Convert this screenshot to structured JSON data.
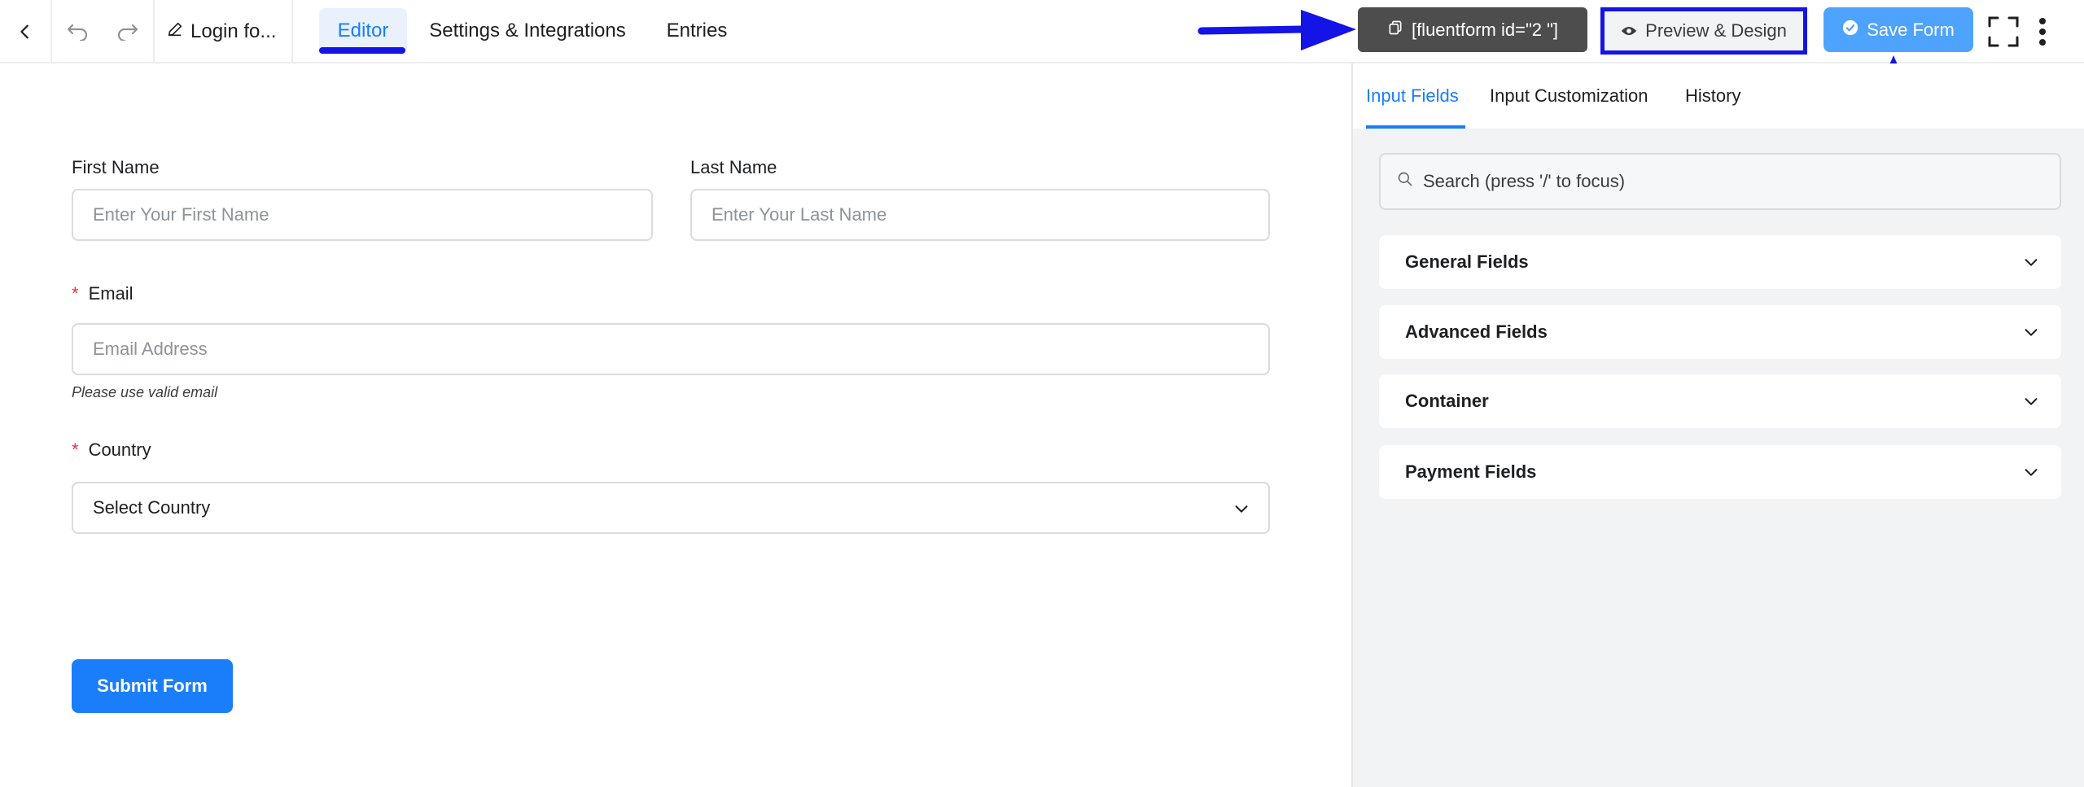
{
  "topbar": {
    "form_title": "Login fo...",
    "tabs": [
      {
        "label": "Editor",
        "active": true
      },
      {
        "label": "Settings & Integrations",
        "active": false
      },
      {
        "label": "Entries",
        "active": false
      }
    ],
    "shortcode_label": "[fluentform id=\"2  \"]",
    "preview_label": "Preview & Design",
    "save_label": "Save Form"
  },
  "form": {
    "first_name": {
      "label": "First Name",
      "placeholder": "Enter Your First Name"
    },
    "last_name": {
      "label": "Last Name",
      "placeholder": "Enter Your Last Name"
    },
    "email": {
      "required_mark": "*",
      "label": "Email",
      "placeholder": "Email Address",
      "help": "Please use valid email"
    },
    "country": {
      "required_mark": "*",
      "label": "Country",
      "selected": "Select Country"
    },
    "submit_label": "Submit Form"
  },
  "panel": {
    "tabs": [
      {
        "label": "Input Fields",
        "active": true
      },
      {
        "label": "Input Customization",
        "active": false
      },
      {
        "label": "History",
        "active": false
      }
    ],
    "search_placeholder": "Search (press '/' to focus)",
    "sections": [
      {
        "label": "General Fields"
      },
      {
        "label": "Advanced Fields"
      },
      {
        "label": "Container"
      },
      {
        "label": "Payment Fields"
      }
    ]
  },
  "colors": {
    "accent": "#1a7efb",
    "annotation": "#1414e6",
    "required": "#e8323c",
    "shortcode_bg": "#4d4d4d"
  },
  "icons": [
    "back-icon",
    "undo-icon",
    "redo-icon",
    "edit-icon",
    "copy-icon",
    "eye-icon",
    "check-circle-icon",
    "fullscreen-icon",
    "more-vertical-icon",
    "search-icon",
    "chevron-down-icon"
  ]
}
